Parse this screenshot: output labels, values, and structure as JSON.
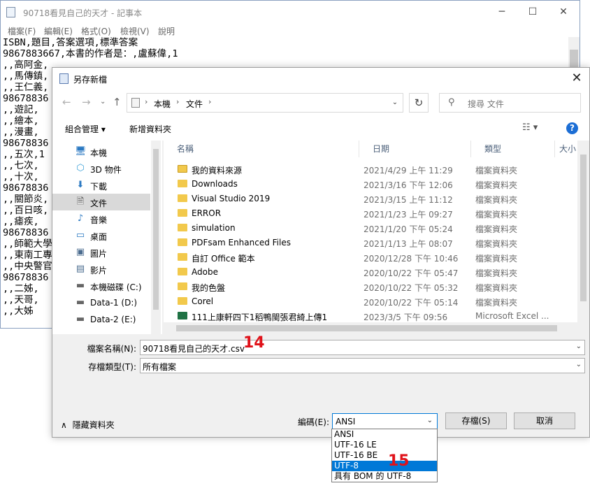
{
  "notepad": {
    "title": "90718看見自己的天才 - 記事本",
    "menu": [
      "檔案(F)",
      "編輯(E)",
      "格式(O)",
      "檢視(V)",
      "說明"
    ],
    "lines": [
      "ISBN,題目,答案選項,標準答案",
      "9867883667,本書的作者是：,盧蘇偉,1",
      ",,高阿金,",
      ",,馬傳鎮,",
      ",,王仁義,",
      "98678836",
      ",,遊記,",
      ",,繪本,",
      ",,漫畫,",
      "98678836",
      ",,五次,1",
      ",,七次,",
      ",,十次,",
      "98678836",
      ",,關節炎,",
      ",,百日咳,",
      ",,瘧疾,",
      "98678836",
      ",,師範大學",
      ",,東南工專",
      ",,中央警官",
      "98678836",
      ",,二姊,",
      ",,天哥,",
      ",,大姊"
    ]
  },
  "dialog": {
    "title": "另存新檔",
    "breadcrumb": [
      "本機",
      "文件"
    ],
    "search_placeholder": "搜尋 文件",
    "toolbar": {
      "organize": "組合管理 ▾",
      "new_folder": "新增資料夾"
    },
    "nav": [
      {
        "label": "本機",
        "icon": "computer-icon"
      },
      {
        "label": "3D 物件",
        "icon": "cube-icon"
      },
      {
        "label": "下載",
        "icon": "download-icon"
      },
      {
        "label": "文件",
        "icon": "document-icon",
        "selected": true
      },
      {
        "label": "音樂",
        "icon": "music-icon"
      },
      {
        "label": "桌面",
        "icon": "desktop-icon"
      },
      {
        "label": "圖片",
        "icon": "pictures-icon"
      },
      {
        "label": "影片",
        "icon": "video-icon"
      },
      {
        "label": "本機磁碟 (C:)",
        "icon": "disk-icon"
      },
      {
        "label": "Data-1 (D:)",
        "icon": "drive-icon"
      },
      {
        "label": "Data-2 (E:)",
        "icon": "drive-icon"
      }
    ],
    "columns": {
      "name": "名稱",
      "date": "日期",
      "type": "類型",
      "size": "大小"
    },
    "files": [
      {
        "name": "我的資料來源",
        "date": "2021/4/29 上午 11:29",
        "type": "檔案資料夾",
        "icon": "special"
      },
      {
        "name": "Downloads",
        "date": "2021/3/16 下午 12:06",
        "type": "檔案資料夾",
        "icon": "folder"
      },
      {
        "name": "Visual Studio 2019",
        "date": "2021/3/15 上午 11:12",
        "type": "檔案資料夾",
        "icon": "folder"
      },
      {
        "name": "ERROR",
        "date": "2021/1/23 上午 09:27",
        "type": "檔案資料夾",
        "icon": "folder"
      },
      {
        "name": "simulation",
        "date": "2021/1/20 下午 05:24",
        "type": "檔案資料夾",
        "icon": "folder"
      },
      {
        "name": "PDFsam Enhanced Files",
        "date": "2021/1/13 上午 08:07",
        "type": "檔案資料夾",
        "icon": "folder"
      },
      {
        "name": "自訂 Office 範本",
        "date": "2020/12/28 下午 10:46",
        "type": "檔案資料夾",
        "icon": "folder"
      },
      {
        "name": "Adobe",
        "date": "2020/10/22 下午 05:47",
        "type": "檔案資料夾",
        "icon": "folder"
      },
      {
        "name": "我的色盤",
        "date": "2020/10/22 下午 05:32",
        "type": "檔案資料夾",
        "icon": "folder"
      },
      {
        "name": "Corel",
        "date": "2020/10/22 下午 05:14",
        "type": "檔案資料夾",
        "icon": "folder"
      },
      {
        "name": "111上康軒四下1稻鴨閩張君綺上傳1",
        "date": "2023/3/5 下午 09:56",
        "type": "Microsoft Excel ...",
        "icon": "excel"
      }
    ],
    "filename_label": "檔案名稱(N):",
    "filename_value": "90718看見自己的天才.csv",
    "filetype_label": "存檔類型(T):",
    "filetype_value": "所有檔案",
    "hide_folders": "隱藏資料夾",
    "encoding_label": "編碼(E):",
    "encoding_value": "ANSI",
    "save_button": "存檔(S)",
    "cancel_button": "取消",
    "encoding_options": [
      "ANSI",
      "UTF-16 LE",
      "UTF-16 BE",
      "UTF-8",
      "具有 BOM 的 UTF-8"
    ],
    "encoding_highlighted": 3
  },
  "annotations": {
    "step_filename": "14",
    "step_encoding": "15"
  },
  "colors": {
    "accent": "#0078d7",
    "annotation": "#e0121a",
    "folder": "#f2c94c"
  }
}
